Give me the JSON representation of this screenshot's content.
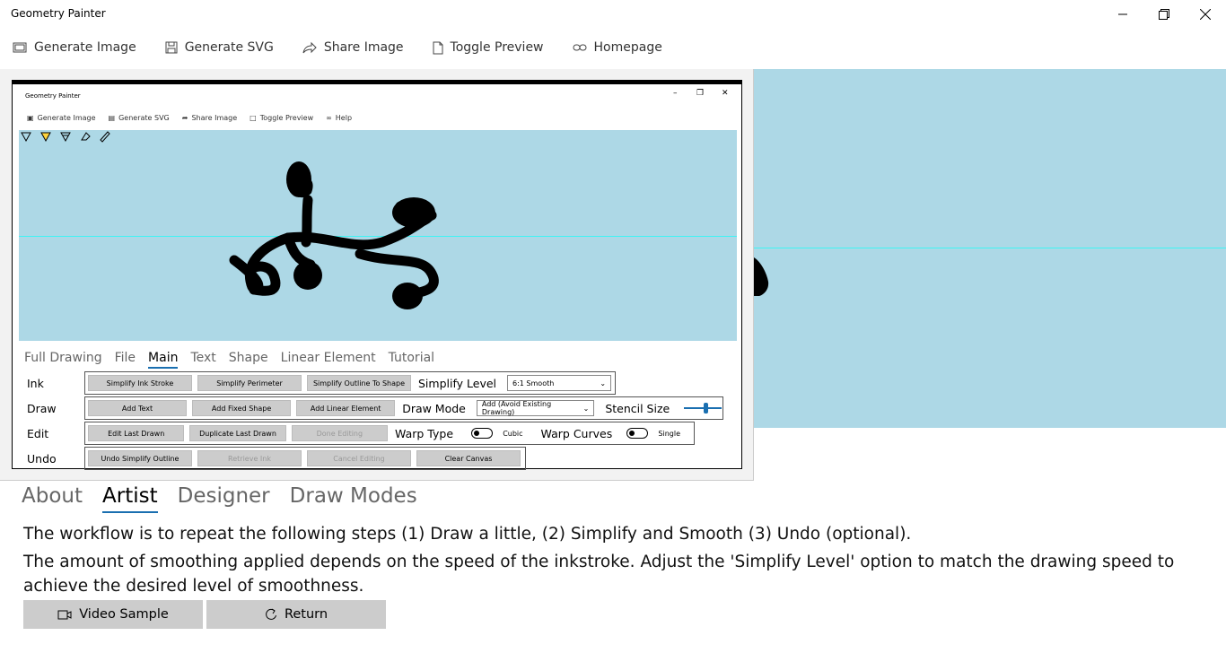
{
  "app": {
    "title": "Geometry Painter"
  },
  "toolbar": {
    "items": [
      "Generate Image",
      "Generate SVG",
      "Share Image",
      "Toggle Preview",
      "Homepage"
    ]
  },
  "preview": {
    "title": "Geometry Painter",
    "toolbar": [
      "Generate Image",
      "Generate SVG",
      "Share Image",
      "Toggle Preview",
      "Help"
    ],
    "tabs": [
      "Full Drawing",
      "File",
      "Main",
      "Text",
      "Shape",
      "Linear Element",
      "Tutorial"
    ],
    "active_tab": "Main",
    "rows": {
      "ink": {
        "label": "Ink",
        "buttons": [
          "Simplify Ink Stroke",
          "Simplify Perimeter",
          "Simplify Outline To Shape"
        ],
        "option_label": "Simplify Level",
        "option_value": "6:1 Smooth"
      },
      "draw": {
        "label": "Draw",
        "buttons": [
          "Add Text",
          "Add Fixed Shape",
          "Add Linear Element"
        ],
        "option_label": "Draw Mode",
        "option_value": "Add (Avoid Existing Drawing)",
        "stencil_label": "Stencil Size"
      },
      "edit": {
        "label": "Edit",
        "buttons": [
          "Edit Last Drawn",
          "Duplicate Last Drawn",
          "Done Editing"
        ],
        "warp_type_label": "Warp Type",
        "warp_type_value": "Cubic",
        "warp_curves_label": "Warp Curves",
        "warp_curves_value": "Single"
      },
      "undo": {
        "label": "Undo",
        "buttons": [
          "Undo Simplify Outline",
          "Retrieve Ink",
          "Cancel Editing",
          "Clear Canvas"
        ]
      }
    }
  },
  "tabs": [
    "About",
    "Artist",
    "Designer",
    "Draw Modes"
  ],
  "active_tab": "Artist",
  "content": {
    "line1": "The workflow is to repeat the following steps (1) Draw a little, (2) Simplify and Smooth (3) Undo (optional).",
    "line2": "The amount of smoothing applied depends on the speed of the inkstroke. Adjust the 'Simplify Level' option to match the drawing speed to achieve the desired level of smoothness."
  },
  "buttons": {
    "video": "Video Sample",
    "return": "Return"
  }
}
